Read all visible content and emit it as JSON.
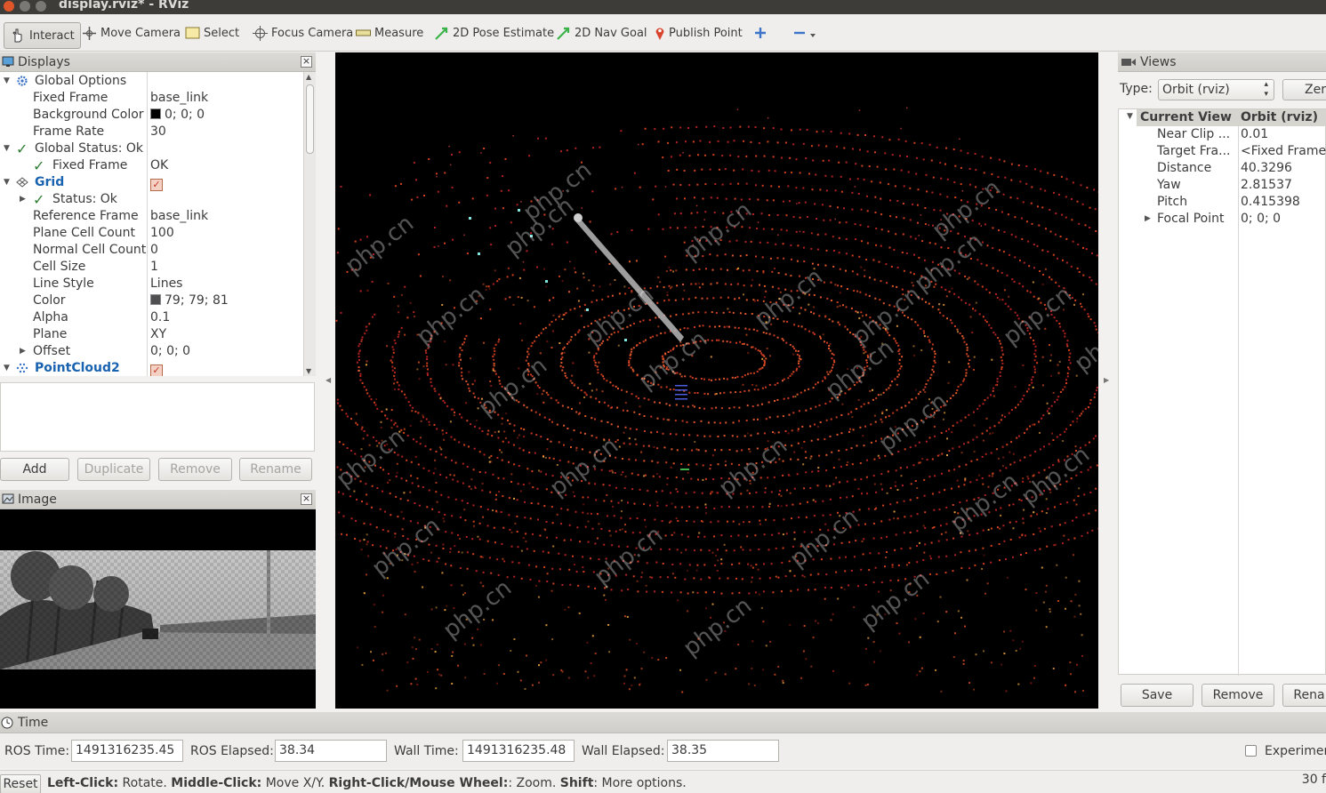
{
  "window": {
    "title": "display.rviz* - RViz"
  },
  "toolbar": {
    "interact": "Interact",
    "move_camera": "Move Camera",
    "select": "Select",
    "focus_camera": "Focus Camera",
    "measure": "Measure",
    "pose_estimate": "2D Pose Estimate",
    "nav_goal": "2D Nav Goal",
    "publish_point": "Publish Point"
  },
  "displays": {
    "title": "Displays",
    "global_options": "Global Options",
    "fixed_frame_k": "Fixed Frame",
    "fixed_frame_v": "base_link",
    "bg_color_k": "Background Color",
    "bg_color_v": "0; 0; 0",
    "frame_rate_k": "Frame Rate",
    "frame_rate_v": "30",
    "global_status": "Global Status: Ok",
    "status_fixed_frame_k": "Fixed Frame",
    "status_fixed_frame_v": "OK",
    "grid": "Grid",
    "grid_status": "Status: Ok",
    "ref_frame_k": "Reference Frame",
    "ref_frame_v": "base_link",
    "plane_cells_k": "Plane Cell Count",
    "plane_cells_v": "100",
    "normal_cells_k": "Normal Cell Count",
    "normal_cells_v": "0",
    "cell_size_k": "Cell Size",
    "cell_size_v": "1",
    "line_style_k": "Line Style",
    "line_style_v": "Lines",
    "color_k": "Color",
    "color_v": "79; 79; 81",
    "alpha_k": "Alpha",
    "alpha_v": "0.1",
    "plane_k": "Plane",
    "plane_v": "XY",
    "offset_k": "Offset",
    "offset_v": "0; 0; 0",
    "pointcloud": "PointCloud2",
    "buttons": {
      "add": "Add",
      "duplicate": "Duplicate",
      "remove": "Remove",
      "rename": "Rename"
    }
  },
  "image_panel": {
    "title": "Image"
  },
  "views": {
    "title": "Views",
    "type_label": "Type:",
    "type_value": "Orbit (rviz)",
    "zero_btn": "Zer",
    "current_view_k": "Current View",
    "current_view_v": "Orbit (rviz)",
    "near_clip_k": "Near Clip ...",
    "near_clip_v": "0.01",
    "target_frame_k": "Target Fra...",
    "target_frame_v": "<Fixed Frame>",
    "distance_k": "Distance",
    "distance_v": "40.3296",
    "yaw_k": "Yaw",
    "yaw_v": "2.81537",
    "pitch_k": "Pitch",
    "pitch_v": "0.415398",
    "focal_point_k": "Focal Point",
    "focal_point_v": "0; 0; 0",
    "buttons": {
      "save": "Save",
      "remove": "Remove",
      "rename": "Rena"
    }
  },
  "time": {
    "title": "Time",
    "ros_time_label": "ROS Time:",
    "ros_time": "1491316235.45",
    "ros_elapsed_label": "ROS Elapsed:",
    "ros_elapsed": "38.34",
    "wall_time_label": "Wall Time:",
    "wall_time": "1491316235.48",
    "wall_elapsed_label": "Wall Elapsed:",
    "wall_elapsed": "38.35",
    "experimental": "Experimen"
  },
  "status": {
    "reset": "Reset",
    "b1": "Left-Click:",
    "t1": " Rotate. ",
    "b2": "Middle-Click:",
    "t2": " Move X/Y. ",
    "b3": "Right-Click/Mouse Wheel:",
    "t3": ": Zoom. ",
    "b4": "Shift",
    "t4": ": More options.",
    "fps": "30 f"
  },
  "watermark": "php.cn"
}
